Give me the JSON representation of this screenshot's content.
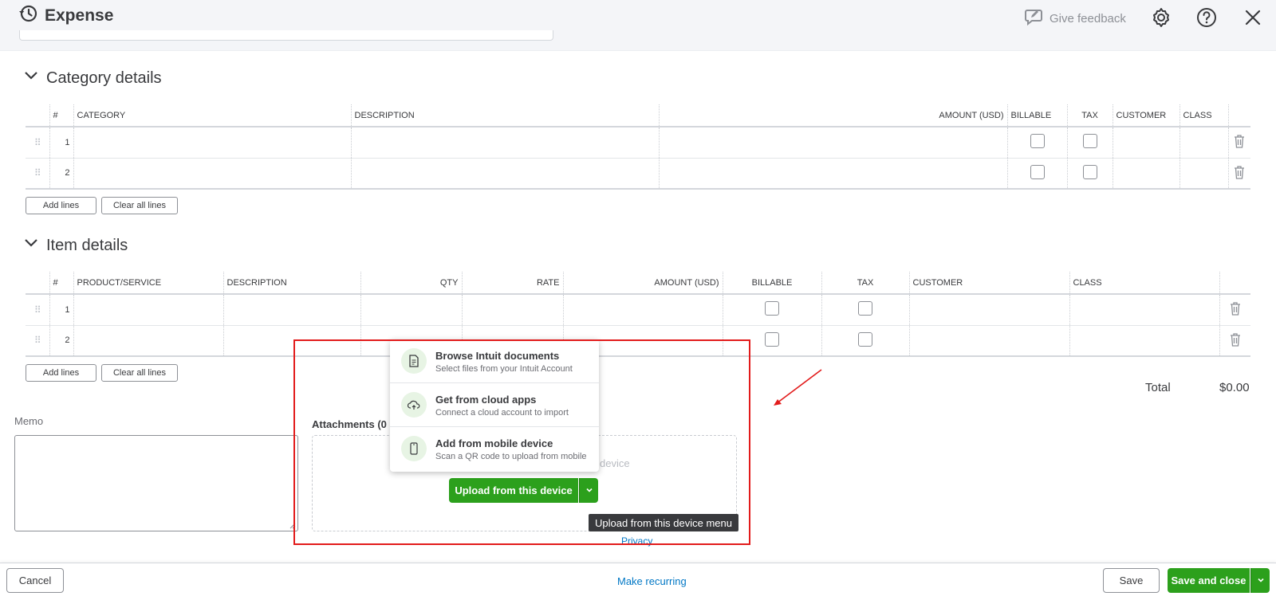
{
  "header": {
    "title": "Expense",
    "feedback_label": "Give feedback"
  },
  "category_details": {
    "title": "Category details",
    "columns": [
      "#",
      "CATEGORY",
      "DESCRIPTION",
      "",
      "AMOUNT (USD)",
      "BILLABLE",
      "TAX",
      "CUSTOMER",
      "CLASS"
    ],
    "rows": [
      {
        "num": "1"
      },
      {
        "num": "2"
      }
    ],
    "add_lines": "Add lines",
    "clear_lines": "Clear all lines"
  },
  "item_details": {
    "title": "Item details",
    "columns": [
      "#",
      "PRODUCT/SERVICE",
      "DESCRIPTION",
      "QTY",
      "RATE",
      "AMOUNT (USD)",
      "BILLABLE",
      "TAX",
      "CUSTOMER",
      "CLASS"
    ],
    "rows": [
      {
        "num": "1"
      },
      {
        "num": "2"
      }
    ],
    "add_lines": "Add lines",
    "clear_lines": "Clear all lines"
  },
  "totals": {
    "label": "Total",
    "value": "$0.00"
  },
  "memo": {
    "label": "Memo"
  },
  "attachments": {
    "label": "Attachments (0",
    "drop_hint": "device",
    "upload_button": "Upload from this device",
    "tooltip": "Upload from this device menu",
    "privacy": "Privacy",
    "menu": [
      {
        "title": "Browse Intuit documents",
        "subtitle": "Select files from your Intuit Account",
        "icon": "document-icon"
      },
      {
        "title": "Get from cloud apps",
        "subtitle": "Connect a cloud account to import",
        "icon": "cloud-icon"
      },
      {
        "title": "Add from mobile device",
        "subtitle": "Scan a QR code to upload from mobile",
        "icon": "mobile-icon"
      }
    ]
  },
  "footer": {
    "cancel": "Cancel",
    "make_recurring": "Make recurring",
    "save": "Save",
    "save_and_close": "Save and close"
  },
  "colors": {
    "primary_green": "#2ca01c",
    "link_blue": "#0077c5",
    "annotation_red": "#e21b1b"
  }
}
